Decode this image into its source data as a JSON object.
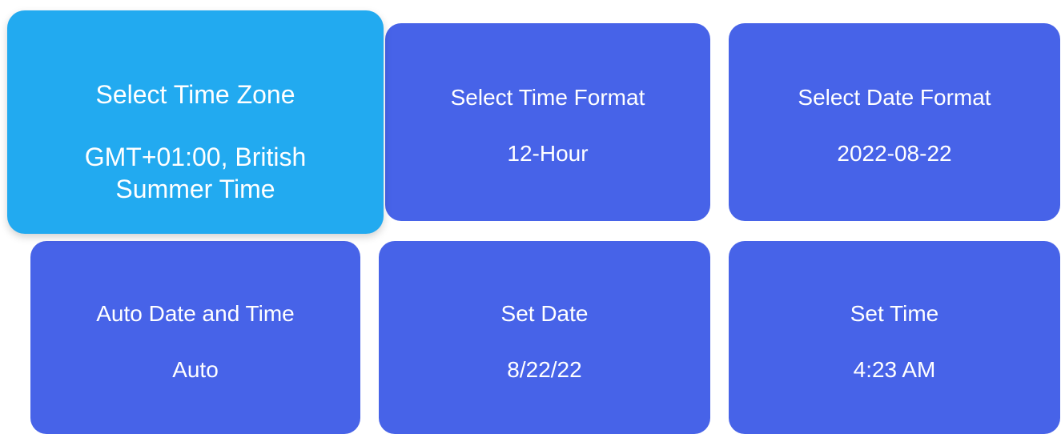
{
  "colors": {
    "tile": "#4763e8",
    "tile_focused": "#22aaf0",
    "text": "#ffffff",
    "background": "#ffffff"
  },
  "tiles": {
    "time_zone": {
      "title": "Select Time Zone",
      "value": "GMT+01:00, British Summer Time",
      "focused": true
    },
    "time_format": {
      "title": "Select Time Format",
      "value": "12-Hour"
    },
    "date_format": {
      "title": "Select Date Format",
      "value": "2022-08-22"
    },
    "auto_date": {
      "title": "Auto Date and Time",
      "value": "Auto"
    },
    "set_date": {
      "title": "Set Date",
      "value": "8/22/22"
    },
    "set_time": {
      "title": "Set Time",
      "value": "4:23 AM"
    }
  }
}
